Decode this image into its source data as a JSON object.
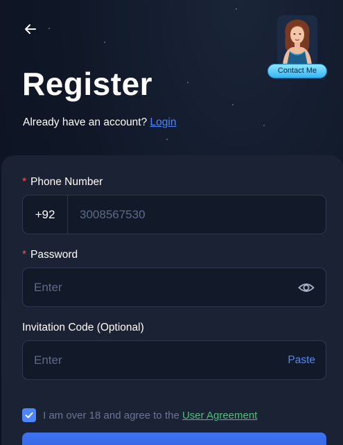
{
  "header": {
    "title": "Register",
    "have_account": "Already have an account?",
    "login_link": "Login",
    "contact_label": "Contact Me"
  },
  "form": {
    "phone": {
      "label": "Phone Number",
      "required_mark": "*",
      "country_code": "+92",
      "placeholder": "3008567530"
    },
    "password": {
      "label": "Password",
      "required_mark": "*",
      "placeholder": "Enter"
    },
    "invite": {
      "label": "Invitation Code (Optional)",
      "placeholder": "Enter",
      "paste_label": "Paste"
    },
    "agreement": {
      "checked": true,
      "text": "I am over 18 and agree to the",
      "link": "User Agreement"
    }
  },
  "colors": {
    "accent": "#4e86ff",
    "agreement_link": "#47c37a",
    "required": "#ff4d4f",
    "background": "#0f1626",
    "card": "#1b2233"
  }
}
